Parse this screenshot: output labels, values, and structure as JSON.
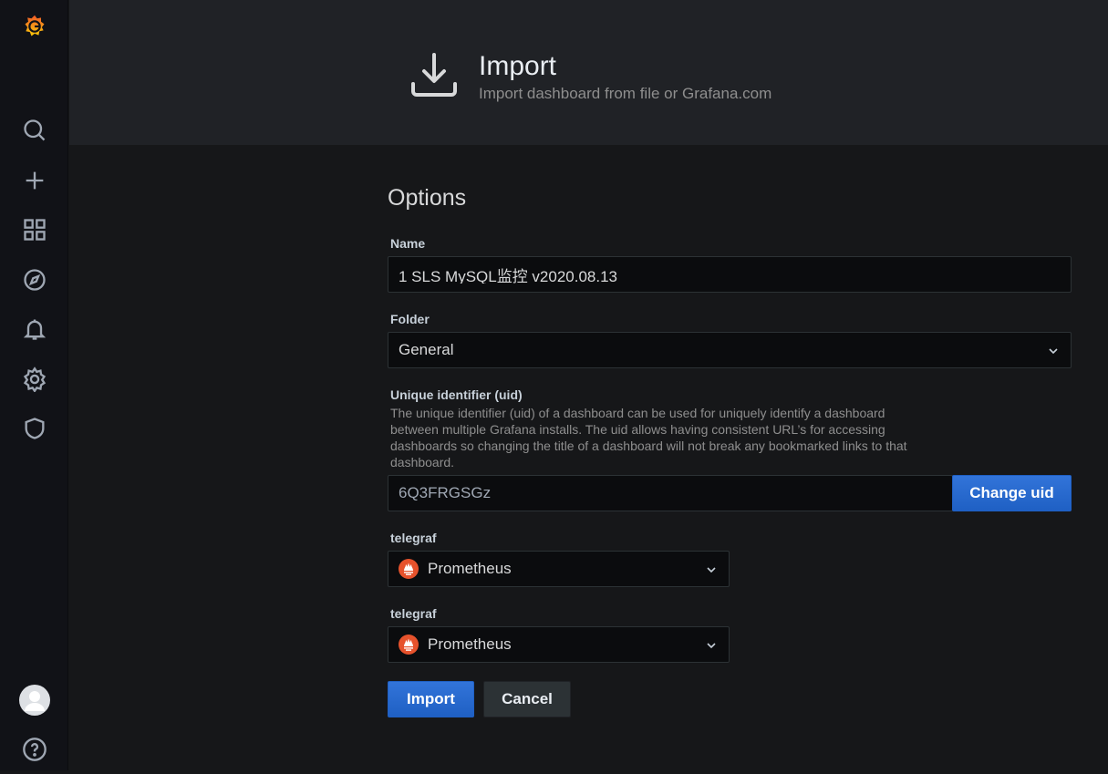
{
  "sidebar": {
    "logo": "grafana-logo",
    "items": [
      {
        "icon": "search-icon"
      },
      {
        "icon": "plus-icon"
      },
      {
        "icon": "dashboards-icon"
      },
      {
        "icon": "explore-icon"
      },
      {
        "icon": "bell-icon"
      },
      {
        "icon": "gear-icon"
      },
      {
        "icon": "shield-icon"
      }
    ],
    "bottom": [
      {
        "icon": "avatar"
      },
      {
        "icon": "help-icon"
      }
    ]
  },
  "header": {
    "icon": "import-icon",
    "title": "Import",
    "subtitle": "Import dashboard from file or Grafana.com"
  },
  "options": {
    "title": "Options",
    "name": {
      "label": "Name",
      "value": "1 SLS MySQL监控 v2020.08.13"
    },
    "folder": {
      "label": "Folder",
      "value": "General"
    },
    "uid": {
      "label": "Unique identifier (uid)",
      "description": "The unique identifier (uid) of a dashboard can be used for uniquely identify a dashboard between multiple Grafana installs. The uid allows having consistent URL’s for accessing dashboards so changing the title of a dashboard will not break any bookmarked links to that dashboard.",
      "value": "6Q3FRGSGz",
      "change_label": "Change uid"
    },
    "datasources": [
      {
        "label": "telegraf",
        "value": "Prometheus",
        "icon": "prometheus-icon"
      },
      {
        "label": "telegraf",
        "value": "Prometheus",
        "icon": "prometheus-icon"
      }
    ]
  },
  "actions": {
    "import_label": "Import",
    "cancel_label": "Cancel"
  },
  "colors": {
    "accent": "#3274d9",
    "background": "#161719",
    "sidebar": "#111217",
    "header": "#202226",
    "grafana_orange": "#f05a28",
    "prometheus": "#e6522c"
  }
}
